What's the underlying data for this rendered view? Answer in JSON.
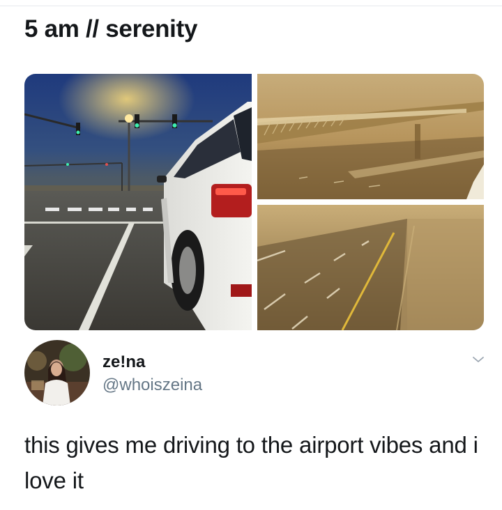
{
  "post": {
    "caption": "5 am // serenity"
  },
  "media": {
    "photos": [
      {
        "description_icon": "night-intersection-suv-photo"
      },
      {
        "description_icon": "foggy-overpass-photo"
      },
      {
        "description_icon": "foggy-highway-photo"
      }
    ]
  },
  "tweet": {
    "display_name": "ze!na",
    "handle": "@whoiszeina",
    "text": "this gives me driving to the airport vibes and i love it",
    "menu_icon": "chevron-down-icon"
  },
  "colors": {
    "text_primary": "#14171a",
    "text_secondary": "#657786",
    "fog_amber": "#b89a5e",
    "night_sky": "#243a78"
  }
}
